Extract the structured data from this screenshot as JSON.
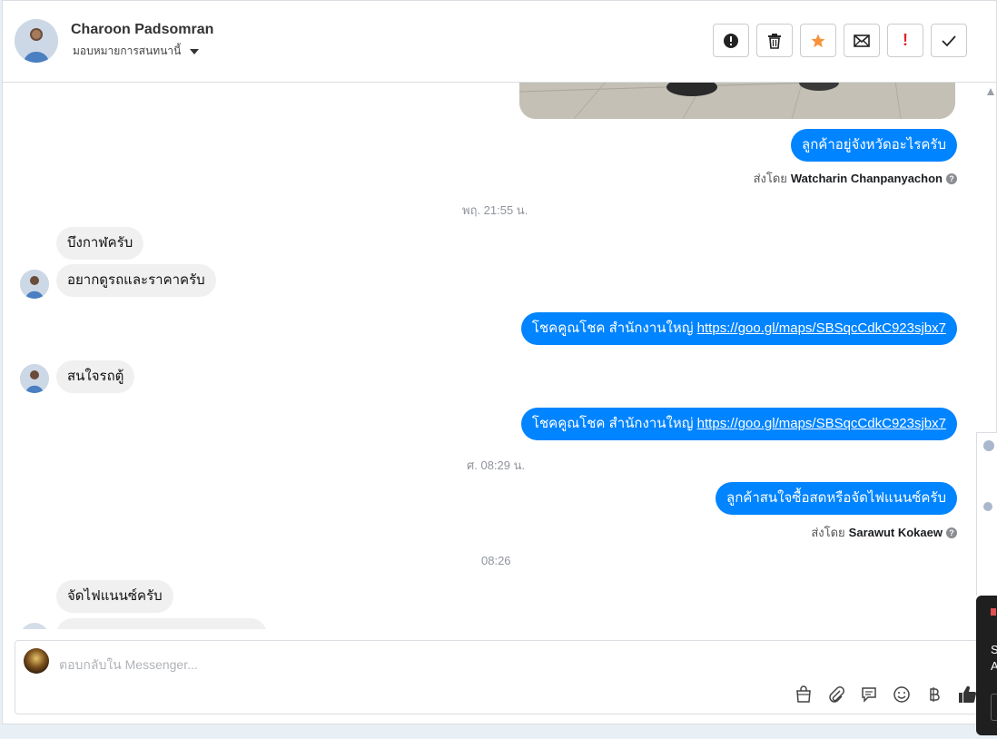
{
  "header": {
    "contact_name": "Charoon Padsomran",
    "assign_label": "มอบหมายการสนทนานี้",
    "toolbar": [
      {
        "name": "report-spam-button",
        "icon": "alert-circle-icon"
      },
      {
        "name": "delete-button",
        "icon": "trash-icon"
      },
      {
        "name": "star-button",
        "icon": "star-icon"
      },
      {
        "name": "mark-unread-button",
        "icon": "envelope-icon"
      },
      {
        "name": "follow-up-button",
        "icon": "exclamation-icon",
        "label": "!"
      },
      {
        "name": "mark-done-button",
        "icon": "checkmark-icon"
      }
    ]
  },
  "thread": {
    "msg_1": "ลูกค้าอยู่จังหวัดอะไรครับ",
    "sentby_prefix": "ส่งโดย",
    "sentby_1": "Watcharin Chanpanyachon",
    "ts_1": "พฤ. 21:55 น.",
    "in_1": "บึงกาฬครับ",
    "in_2": "อยากดูรถและราคาครับ",
    "link_text_prefix": "โชคคูณโชค สำนักงานใหญ่",
    "link_url": "https://goo.gl/maps/SBSqcCdkC923sjbx7",
    "in_3": "สนใจรถตู้",
    "ts_2": "ศ. 08:29 น.",
    "msg_4": "ลูกค้าสนใจซื้อสดหรือจัดไฟแนนซ์ครับ",
    "sentby_2": "Sarawut Kokaew",
    "ts_3": "08:26",
    "in_4": "จัดไฟแนนซ์ครับ"
  },
  "composer": {
    "placeholder": "ตอบกลับใน Messenger...",
    "icons": [
      "shopping-bag-icon",
      "paperclip-icon",
      "chat-bubble-icon",
      "emoji-icon",
      "baht-icon",
      "thumbs-up-icon"
    ]
  },
  "side_panel": {
    "line1": "S",
    "line2": "A"
  },
  "colors": {
    "accent": "#0084ff",
    "incoming_bubble": "#f0f0f0",
    "star": "#f7923b",
    "alert_red": "#e0262c"
  }
}
